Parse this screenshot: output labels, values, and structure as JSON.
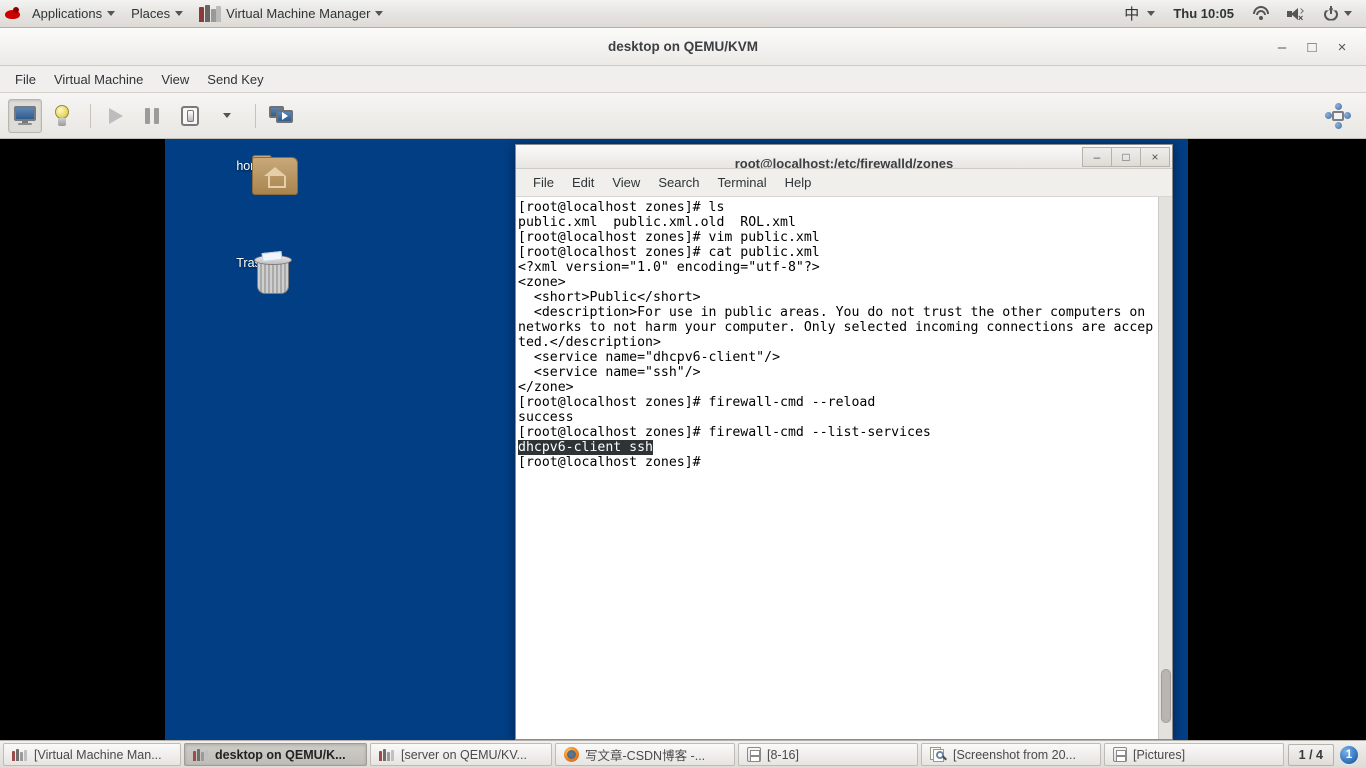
{
  "gnome_panel": {
    "applications_label": "Applications",
    "places_label": "Places",
    "app_window_label": "Virtual Machine Manager",
    "ime_label": "中",
    "clock": "Thu 10:05",
    "icons": [
      "redhat-logo",
      "wifi-icon",
      "speaker-muted-icon",
      "power-icon",
      "chevron-down-icon"
    ]
  },
  "vmm_window": {
    "title": "desktop on QEMU/KVM",
    "window_buttons": {
      "minimize": "–",
      "maximize": "□",
      "close": "×"
    },
    "menus": [
      "File",
      "Virtual Machine",
      "View",
      "Send Key"
    ],
    "toolbar": [
      {
        "name": "show-console",
        "icon": "monitor-icon",
        "active": true
      },
      {
        "name": "show-details",
        "icon": "lightbulb-icon",
        "active": false
      },
      {
        "name": "run-vm",
        "icon": "play-icon",
        "active": false
      },
      {
        "name": "pause-vm",
        "icon": "pause-icon",
        "active": false
      },
      {
        "name": "shutdown-vm",
        "icon": "shutdown-icon",
        "active": false
      },
      {
        "name": "shutdown-options",
        "icon": "chevron-down-icon",
        "active": false
      },
      {
        "name": "take-snapshot",
        "icon": "screens-icon",
        "active": false
      },
      {
        "name": "resize-to-vm",
        "icon": "resize-arrows-icon",
        "active": false
      }
    ]
  },
  "vm_desktop": {
    "icons": [
      {
        "label": "home",
        "icon": "home-folder-icon"
      },
      {
        "label": "Trash",
        "icon": "trash-icon"
      }
    ]
  },
  "terminal": {
    "title": "root@localhost:/etc/firewalld/zones",
    "window_buttons": {
      "minimize": "–",
      "maximize": "□",
      "close": "×"
    },
    "menus": [
      "File",
      "Edit",
      "View",
      "Search",
      "Terminal",
      "Help"
    ],
    "lines": [
      {
        "text": "[root@localhost zones]# ls",
        "selected": false
      },
      {
        "text": "public.xml  public.xml.old  ROL.xml",
        "selected": false
      },
      {
        "text": "[root@localhost zones]# vim public.xml",
        "selected": false
      },
      {
        "text": "[root@localhost zones]# cat public.xml",
        "selected": false
      },
      {
        "text": "<?xml version=\"1.0\" encoding=\"utf-8\"?>",
        "selected": false
      },
      {
        "text": "<zone>",
        "selected": false
      },
      {
        "text": "  <short>Public</short>",
        "selected": false
      },
      {
        "text": "  <description>For use in public areas. You do not trust the other computers on",
        "selected": false
      },
      {
        "text": "networks to not harm your computer. Only selected incoming connections are accep",
        "selected": false
      },
      {
        "text": "ted.</description>",
        "selected": false
      },
      {
        "text": "  <service name=\"dhcpv6-client\"/>",
        "selected": false
      },
      {
        "text": "  <service name=\"ssh\"/>",
        "selected": false
      },
      {
        "text": "</zone>",
        "selected": false
      },
      {
        "text": "[root@localhost zones]# firewall-cmd --reload",
        "selected": false
      },
      {
        "text": "success",
        "selected": false
      },
      {
        "text": "[root@localhost zones]# firewall-cmd --list-services",
        "selected": false
      },
      {
        "text": "dhcpv6-client ssh",
        "selected": true
      },
      {
        "text": "[root@localhost zones]#",
        "selected": false
      }
    ]
  },
  "taskbar": {
    "buttons": [
      {
        "label": "[Virtual Machine Man...",
        "icon": "vmm-icon",
        "active": false
      },
      {
        "label": "desktop on QEMU/K...",
        "icon": "vmm-icon",
        "active": true
      },
      {
        "label": "[server on QEMU/KV...",
        "icon": "vmm-icon",
        "active": false
      },
      {
        "label": "写文章-CSDN博客 -...",
        "icon": "firefox-icon",
        "active": false
      },
      {
        "label": "[8-16]",
        "icon": "files-icon",
        "active": false
      },
      {
        "label": "[Screenshot from 20...",
        "icon": "screenshot-icon",
        "active": false
      },
      {
        "label": "[Pictures]",
        "icon": "files-icon",
        "active": false
      }
    ],
    "workspace": "1 / 4",
    "notification_count": "1"
  },
  "colors": {
    "desktop_blue": "#023e84",
    "panel_grey": "#e6e4e1",
    "terminal_bg": "#ffffff",
    "terminal_fg": "#000000",
    "selection_bg": "#2e3436"
  }
}
